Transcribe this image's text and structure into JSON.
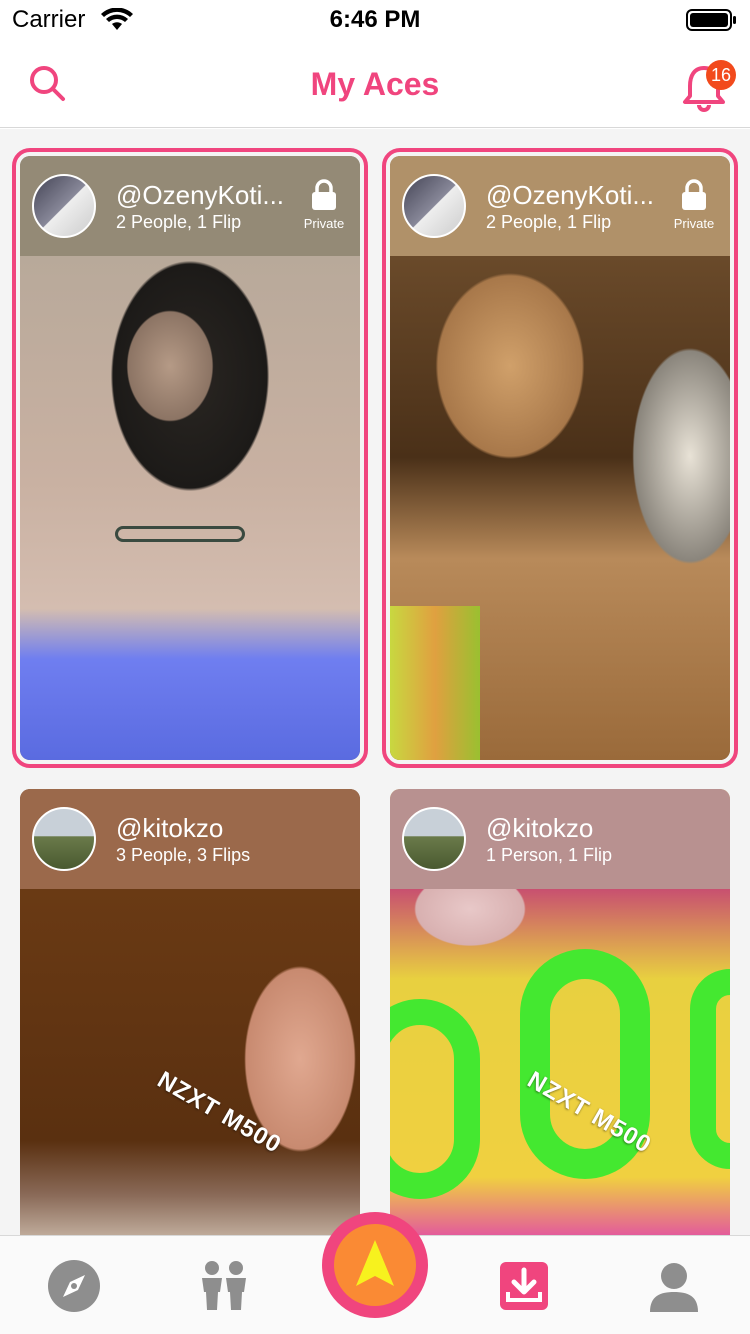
{
  "status_bar": {
    "carrier": "Carrier",
    "time": "6:46 PM"
  },
  "nav": {
    "title": "My Aces",
    "search_icon": "search-icon",
    "notifications_icon": "bell-icon",
    "notification_count": "16"
  },
  "colors": {
    "accent": "#f0457e",
    "badge": "#f24a1c",
    "center_button_inner": "#fa8a34",
    "arrow": "#f7f21e"
  },
  "cards": [
    {
      "owner": "@OzenyKoti...",
      "meta": "2 People, 1 Flip",
      "private_label": "Private",
      "selected": true
    },
    {
      "owner": "@OzenyKoti...",
      "meta": "2 People, 1 Flip",
      "private_label": "Private",
      "selected": true
    },
    {
      "owner": "@kitokzo",
      "meta": "3 People, 3 Flips",
      "overlay": "NZXT M500",
      "selected": false
    },
    {
      "owner": "@kitokzo",
      "meta": "1 Person, 1 Flip",
      "overlay": "NZXT M500",
      "selected": false
    }
  ],
  "tab_bar": {
    "items": [
      "compass-icon",
      "people-icon",
      "center-arrow-icon",
      "inbox-download-icon",
      "profile-icon"
    ],
    "active": "inbox-download-icon"
  }
}
